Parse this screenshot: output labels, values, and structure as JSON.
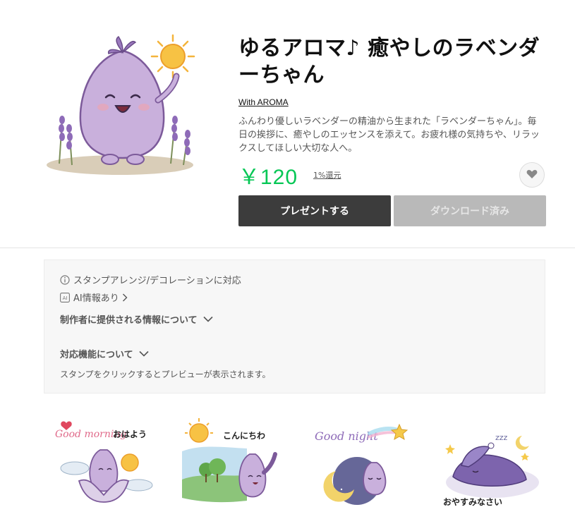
{
  "product": {
    "title": "ゆるアロマ♪ 癒やしのラベンダーちゃん",
    "author": "With AROMA",
    "description": "ふんわり優しいラベンダーの精油から生まれた「ラベンダーちゃん」。毎日の挨拶に、癒やしのエッセンスを添えて。お疲れ様の気持ちや、リラックスしてほしい大切な人へ。",
    "price": "￥120",
    "rebate": "1%還元"
  },
  "actions": {
    "present_label": "プレゼントする",
    "download_label": "ダウンロード済み"
  },
  "details": {
    "arrange_note": "スタンプアレンジ/デコレーションに対応",
    "ai_label": "AI情報あり",
    "creator_info_heading": "制作者に提供される情報について",
    "features_heading": "対応機能について",
    "preview_hint": "スタンプをクリックするとプレビューが表示されます。"
  },
  "stickers": [
    {
      "text": "おはよう",
      "script": "Good morning"
    },
    {
      "text": "こんにちわ",
      "script": ""
    },
    {
      "text": "",
      "script": "Good night"
    },
    {
      "text": "おやすみなさい",
      "script": ""
    }
  ],
  "colors": {
    "price_green": "#06c755",
    "present_bg": "#3c3c3c",
    "download_bg": "#b9b9b9",
    "lavender": "#b9a3cf"
  },
  "icons": [
    "heart-icon",
    "info-icon",
    "ai-icon",
    "chevron-right-icon",
    "chevron-down-icon"
  ]
}
